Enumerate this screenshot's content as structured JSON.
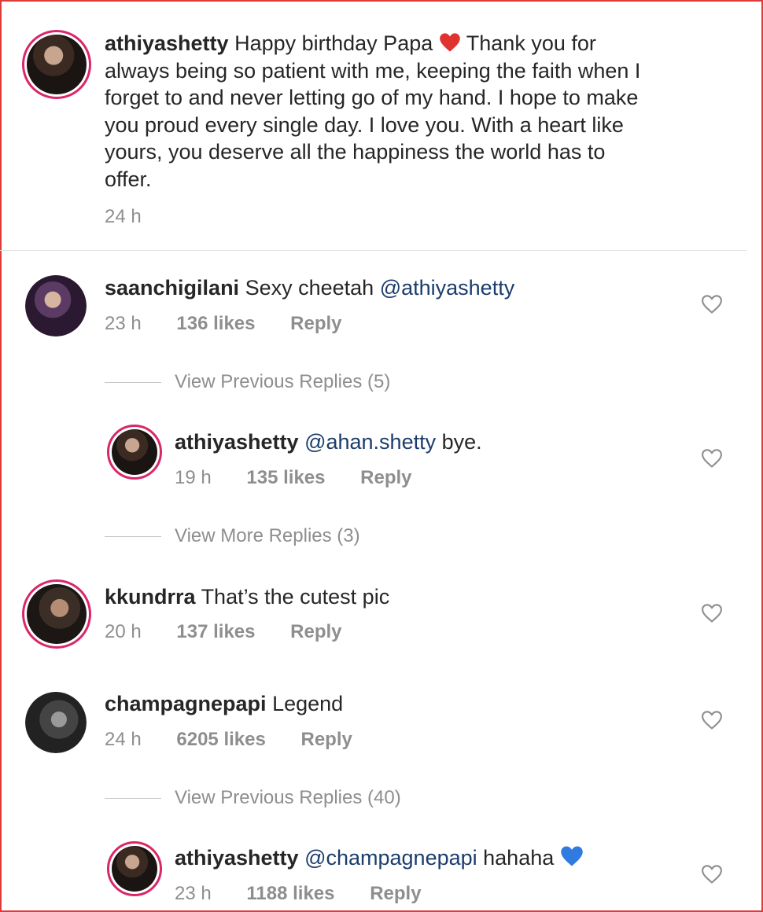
{
  "caption": {
    "username": "athiyashetty",
    "text_before_emoji": "Happy birthday Papa",
    "emoji": "red-heart-emoji",
    "text_after_emoji": "Thank you for",
    "lines": [
      "always being so patient with me, keeping the faith when I",
      "forget to and never letting go of my hand. I hope to make",
      "you proud every single day. I love you. With a heart like",
      "yours, you deserve all the happiness the world has to",
      "offer."
    ],
    "time": "24 h"
  },
  "comments": [
    {
      "username": "saanchigilani",
      "text": "Sexy cheetah ",
      "mention": "@athiyashetty",
      "time": "23 h",
      "likes": "136 likes",
      "reply": "Reply"
    },
    {
      "username": "kkundrra",
      "text": "That’s the cutest pic",
      "time": "20 h",
      "likes": "137 likes",
      "reply": "Reply"
    },
    {
      "username": "champagnepapi",
      "text": "Legend",
      "time": "24 h",
      "likes": "6205 likes",
      "reply": "Reply"
    }
  ],
  "replies": [
    {
      "username": "athiyashetty",
      "mention": "@ahan.shetty",
      "text": " bye.",
      "time": "19 h",
      "likes": "135 likes",
      "reply": "Reply"
    },
    {
      "username": "athiyashetty",
      "mention": "@champagnepapi",
      "text": " hahaha",
      "emoji": "blue-heart-emoji",
      "time": "23 h",
      "likes": "1188 likes",
      "reply": "Reply"
    }
  ],
  "view_links": {
    "previous_5": "View Previous Replies (5)",
    "more_3": "View More Replies (3)",
    "previous_40": "View Previous Replies (40)"
  },
  "colors": {
    "frame_border": "#e03b3b",
    "mention": "#1b3d6b",
    "meta": "#8e8e8e",
    "story_ring": "#d9276a"
  }
}
